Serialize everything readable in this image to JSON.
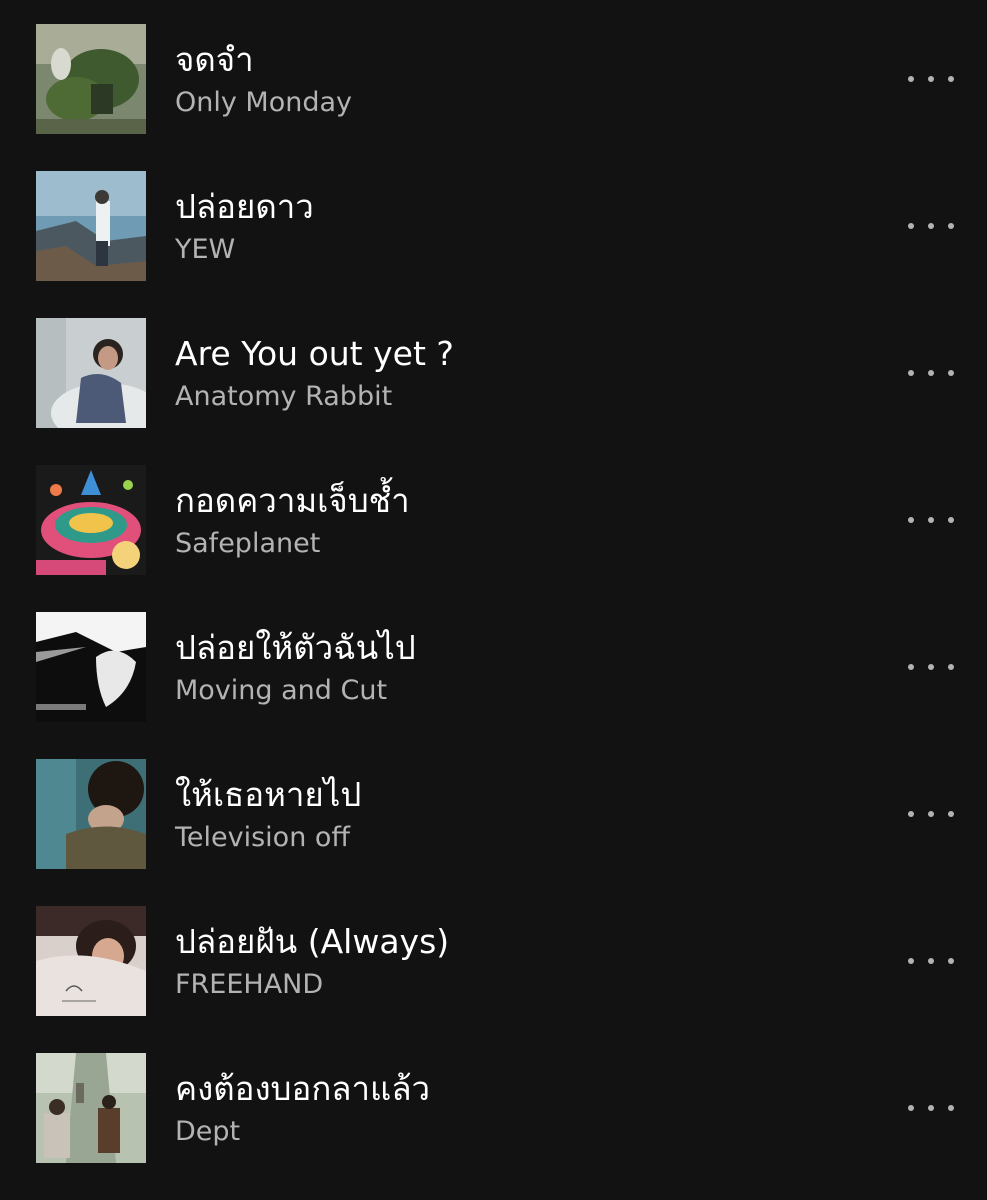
{
  "tracks": [
    {
      "title": "จดจำ",
      "artist": "Only Monday"
    },
    {
      "title": "ปล่อยดาว",
      "artist": "YEW"
    },
    {
      "title": "Are You out yet ?",
      "artist": "Anatomy Rabbit"
    },
    {
      "title": "กอดความเจ็บช้ำ",
      "artist": "Safeplanet"
    },
    {
      "title": "ปล่อยให้ตัวฉันไป",
      "artist": "Moving and Cut"
    },
    {
      "title": "ให้เธอหายไป",
      "artist": "Television off"
    },
    {
      "title": "ปล่อยฝัน (Always)",
      "artist": "FREEHAND"
    },
    {
      "title": "คงต้องบอกลาแล้ว",
      "artist": "Dept"
    }
  ],
  "more_icon": "more-options-icon",
  "colors": {
    "background": "#121212",
    "title": "#ffffff",
    "artist": "#b3b3b3"
  }
}
